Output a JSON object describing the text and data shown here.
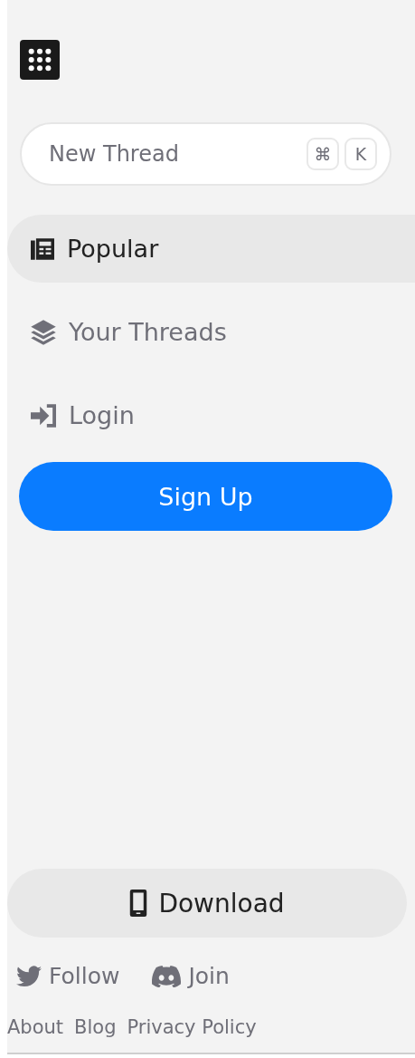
{
  "search": {
    "placeholder": "New Thread",
    "shortcut_keys": [
      "⌘",
      "K"
    ]
  },
  "nav": [
    {
      "label": "Popular",
      "selected": true
    },
    {
      "label": "Your Threads",
      "selected": false
    },
    {
      "label": "Login",
      "selected": false
    }
  ],
  "signup_button": "Sign Up",
  "download_button": "Download",
  "social": [
    "Follow",
    "Join"
  ],
  "footer_links": [
    "About",
    "Blog",
    "Privacy Policy"
  ]
}
